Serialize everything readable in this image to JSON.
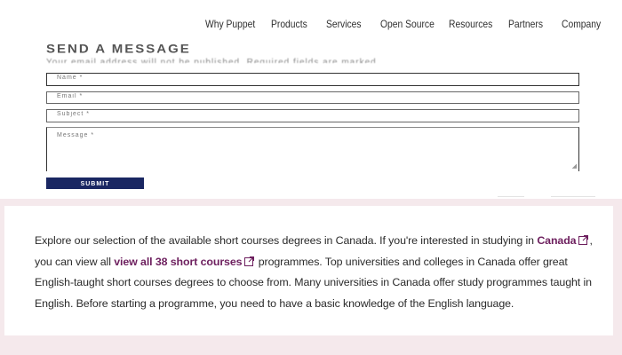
{
  "nav": {
    "items": [
      "Why Puppet",
      "Products",
      "Services",
      "Open Source",
      "Resources",
      "Partners",
      "Company"
    ]
  },
  "form": {
    "title": "SEND A MESSAGE",
    "note": "Your email address will not be published. Required fields are marked.",
    "name_placeholder": "Name *",
    "email_placeholder": "Email *",
    "subject_placeholder": "Subject *",
    "message_placeholder": "Message *",
    "submit_label": "SUBMIT"
  },
  "content": {
    "text1": "Explore our selection of the available short courses degrees in Canada. If you're interested in studying in ",
    "link1": "Canada",
    "text2": ", you can view all ",
    "link2": "view all 38 short courses",
    "text3": " programmes. Top universities and colleges in Canada offer great English-taught short courses degrees to choose from. Many universities in Canada offer study programmes taught in English. Before starting a programme, you need to have a basic knowledge of the English language.",
    "link_color": "#6d1f5e",
    "band_color": "#f5e9ec",
    "button_color": "#1a2762"
  }
}
